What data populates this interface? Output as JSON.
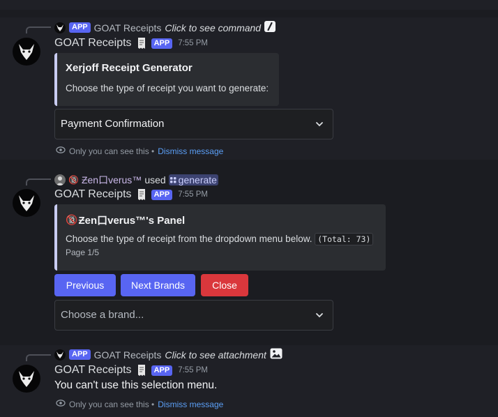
{
  "messages": [
    {
      "reply": {
        "app_tag": "APP",
        "bot_name": "GOAT Receipts",
        "action": "Click to see command",
        "icon": "slash-command-icon"
      },
      "author": {
        "name": "GOAT Receipts",
        "app_tag": "APP",
        "timestamp": "7:55 PM"
      },
      "embed": {
        "title": "Xerjoff Receipt Generator",
        "description": "Choose the type of receipt you want to generate:"
      },
      "select": {
        "value": "Payment Confirmation"
      },
      "ephemeral": {
        "text": "Only you can see this •",
        "dismiss": "Dismiss message"
      }
    },
    {
      "reply": {
        "user_name": "Ƶen口verus™",
        "badge": "🔞",
        "verb": "used",
        "command": "generate"
      },
      "author": {
        "name": "GOAT Receipts",
        "app_tag": "APP",
        "timestamp": "7:55 PM"
      },
      "embed": {
        "title_badge": "🔞",
        "title": "Ƶen口verus™'s Panel",
        "description": "Choose the type of receipt from the dropdown menu below.",
        "code": "(Total: 73)",
        "footer": "Page 1/5"
      },
      "buttons": {
        "previous": "Previous",
        "next": "Next Brands",
        "close": "Close"
      },
      "select": {
        "placeholder": "Choose a brand..."
      }
    },
    {
      "reply": {
        "app_tag": "APP",
        "bot_name": "GOAT Receipts",
        "action": "Click to see attachment",
        "icon": "image-icon"
      },
      "author": {
        "name": "GOAT Receipts",
        "app_tag": "APP",
        "timestamp": "7:55 PM"
      },
      "content": "You can't use this selection menu.",
      "ephemeral": {
        "text": "Only you can see this •",
        "dismiss": "Dismiss message"
      }
    }
  ],
  "colors": {
    "accent": "#5865f2",
    "danger": "#da373c",
    "link": "#5b9ff6",
    "embed_bar": "#c9ccf2"
  }
}
